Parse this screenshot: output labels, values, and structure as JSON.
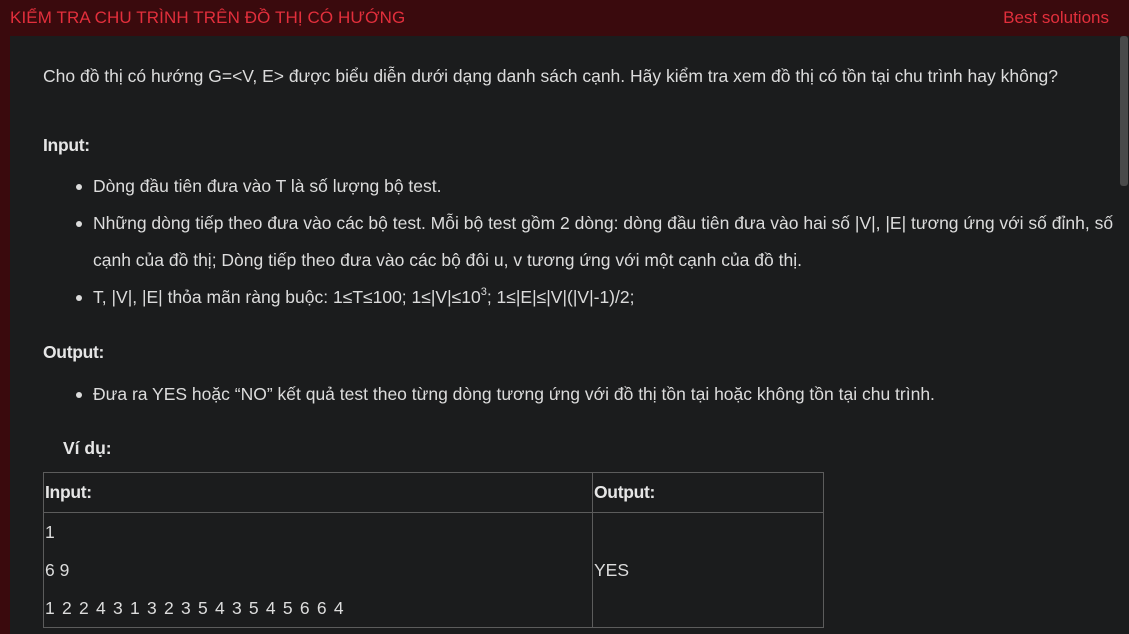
{
  "header": {
    "title": "KIỂM TRA CHU TRÌNH TRÊN ĐỒ THỊ CÓ HƯỚNG",
    "best_solutions": "Best solutions"
  },
  "problem": {
    "statement": "Cho đồ thị có hướng G=<V, E> được biểu diễn dưới dạng danh sách cạnh. Hãy kiểm tra xem đồ thị có tồn tại chu trình hay không?",
    "input_label": "Input:",
    "input_items": [
      "Dòng đầu tiên đưa vào T là số lượng bộ test.",
      "Những dòng tiếp theo đưa vào các bộ test. Mỗi bộ test gồm 2 dòng: dòng đầu tiên đưa vào hai số |V|, |E| tương ứng với số đỉnh,  số cạnh của đồ thị; Dòng tiếp theo đưa vào các bộ đôi u, v tương ứng với một cạnh của đồ thị."
    ],
    "constraint_prefix": "T, |V|, |E| thỏa mãn ràng buộc: 1≤T≤100; 1≤|V|≤10",
    "constraint_sup": "3",
    "constraint_suffix": "; 1≤|E|≤|V|(|V|-1)/2;",
    "output_label": "Output:",
    "output_items": [
      "Đưa ra YES hoặc “NO” kết quả test theo từng dòng tương ứng với đồ thị tồn tại hoặc không tồn tại chu trình."
    ],
    "example_label": "Ví dụ:"
  },
  "example_table": {
    "input_header": "Input:",
    "output_header": "Output:",
    "input_lines": [
      "1",
      "6 9",
      "1 2 2 4 3 1 3 2 3 5 4 3 5 4 5 6 6 4"
    ],
    "output_value": "YES"
  },
  "colors": {
    "accent": "#e22f3c",
    "header_bg": "#3a0a0d",
    "content_bg": "#1b1c1d",
    "text": "#dcdcdc"
  }
}
